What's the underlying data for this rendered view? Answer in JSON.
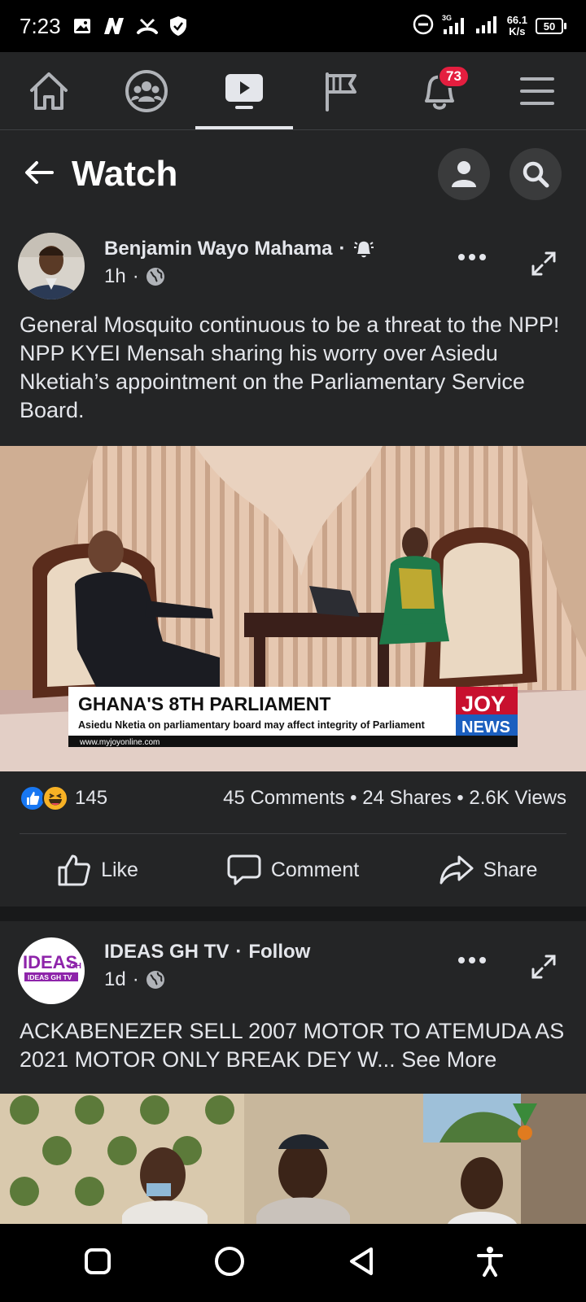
{
  "status_bar": {
    "time": "7:23",
    "net_speed_value": "66.1",
    "net_speed_unit": "K/s",
    "network_type": "3G",
    "battery": "50"
  },
  "top_nav": {
    "notifications_count": "73"
  },
  "header": {
    "title": "Watch"
  },
  "posts": [
    {
      "author": "Benjamin Wayo Mahama",
      "time": "1h",
      "text": "General Mosquito continuous to be a threat to the NPP! NPP KYEI Mensah sharing his worry over Asiedu Nketiah’s appointment on the Parliamentary Service Board.",
      "video": {
        "banner_title": "GHANA'S 8TH PARLIAMENT",
        "banner_subtitle": "Asiedu Nketia on parliamentary board may affect integrity of Parliament",
        "banner_url": "www.myjoyonline.com",
        "logo_top": "JOY",
        "logo_bottom": "NEWS"
      },
      "reactions_count": "145",
      "stats": "45 Comments • 24 Shares • 2.6K Views",
      "actions": {
        "like": "Like",
        "comment": "Comment",
        "share": "Share"
      }
    },
    {
      "author": "IDEAS GH TV",
      "follow": "Follow",
      "time": "1d",
      "avatar_text": "IDEAS",
      "avatar_sub": "GH",
      "avatar_caption": "IDEAS GH TV",
      "text": "ACKABENEZER  SELL 2007 MOTOR TO ATEMUDA AS 2021 MOTOR ONLY BREAK DEY W...",
      "see_more": "See More"
    }
  ],
  "colors": {
    "background": "#18191a",
    "card": "#242526",
    "text": "#e4e6eb",
    "badge": "#e41e3f",
    "like_blue": "#1877f2"
  }
}
